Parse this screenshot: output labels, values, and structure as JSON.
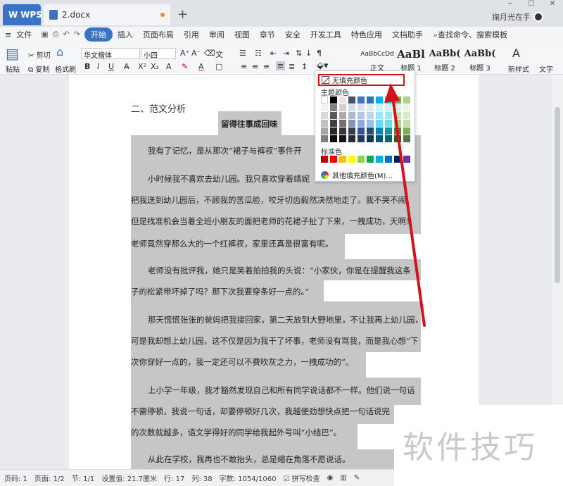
{
  "titlebar": {
    "app_tab": "WPS",
    "doc_tab": "2.docx",
    "user_name": "掬月光在手"
  },
  "menu": {
    "file": "文件",
    "items": [
      "开始",
      "插入",
      "页面布局",
      "引用",
      "审阅",
      "视图",
      "章节",
      "安全",
      "开发工具",
      "特色应用",
      "文档助手"
    ],
    "search": "查找命令、搜索模板"
  },
  "ribbon": {
    "paste": "粘贴",
    "cut": "剪切",
    "copy": "复制",
    "format_painter": "格式刷",
    "font_name": "华文楷体",
    "font_size": "小四",
    "styles": [
      {
        "preview": "AaBbCcDd",
        "label": "正文"
      },
      {
        "preview": "AaBl",
        "label": "标题 1"
      },
      {
        "preview": "AaBb(",
        "label": "标题 2"
      },
      {
        "preview": "AaBb(",
        "label": "标题 3"
      }
    ],
    "new_style": "新样式",
    "text_tool": "文字"
  },
  "shading_popup": {
    "no_fill": "无填充颜色",
    "theme_colors_label": "主题颜色",
    "standard_colors_label": "标准色",
    "more_colors": "其他填充颜色(M)...",
    "theme_colors": [
      [
        "#ffffff",
        "#000000",
        "#e7e6e6",
        "#44546a",
        "#4472c4",
        "#2e75b6",
        "#00b0f0",
        "#26c6da",
        "#70ad47",
        "#a9d18e"
      ],
      [
        "#f2f2f2",
        "#7f7f7f",
        "#d0cece",
        "#d6dce4",
        "#d9e1f2",
        "#ddebf7",
        "#ccf2ff",
        "#ccf5f8",
        "#e2efda",
        "#ecf4e4"
      ],
      [
        "#d9d9d9",
        "#595959",
        "#aeaaaa",
        "#adb9ca",
        "#b4c6e7",
        "#bdd7ee",
        "#99e6ff",
        "#99ebf1",
        "#c6e0b4",
        "#d9e9cb"
      ],
      [
        "#bfbfbf",
        "#404040",
        "#757171",
        "#8497b0",
        "#8ea9db",
        "#9bc2e6",
        "#66d9ff",
        "#66e1ea",
        "#a9d08e",
        "#c5deb1"
      ],
      [
        "#a6a6a6",
        "#262626",
        "#3a3838",
        "#333f4f",
        "#2f5597",
        "#1f4e78",
        "#0085b4",
        "#0d9aa5",
        "#548235",
        "#7fae5b"
      ],
      [
        "#808080",
        "#0d0d0d",
        "#161616",
        "#222a35",
        "#203864",
        "#143450",
        "#005878",
        "#08676e",
        "#375623",
        "#557a3d"
      ]
    ],
    "standard_colors": [
      "#c00000",
      "#ff0000",
      "#ffc000",
      "#ffff00",
      "#92d050",
      "#00b050",
      "#00b0f0",
      "#0070c0",
      "#002060",
      "#7030a0"
    ]
  },
  "document": {
    "section_heading": "二、范文分析",
    "title": "留得往事成回味",
    "paragraphs": [
      "我有了记忆，是从那次“裙子与裤衩”事件开",
      "小时候我不喜欢去幼儿园。我只喜欢穿着靖妮",
      "把我送到幼儿园后，不顾我的苦瓜脸，咬牙切齿毅然决然地走了。我不哭不闹，",
      "但是找准机会当着全班小朋友的面把老师的花裙子扯了下来，一拽成功，天啊！",
      "老师竟然穿那么大的一个红裤衩，家里还真是很富有呢。",
      "老师没有批评我，她只是笑着拍拍我的头说：“小家伙，你是在提醒我这条",
      "子的松紧带坏掉了吗？那下次我要穿条好一点的。”",
      "那天慌慌张张的爸妈把我接回家，第二天放到大野地里，不让我再上幼儿园，",
      "可是我却想上幼儿园，这不仅是因为我干了坏事，老师没有骂我，而是我心想“下",
      "次你穿好一点的，我一定还可以不费吹灰之力，一拽成功的”。",
      "上小学一年级，我才豁然发现自己和所有同学说话都不一样。他们说一句话",
      "不需停顿，我说一句话，却要停顿好几次，我越使劲想快点把一句话说完",
      "的次数就越多，语文学得好的同学给我起外号叫“小结巴”。",
      "从此在学校，我再也不敢抬头，总是缩在角落不愿说话。"
    ]
  },
  "status": {
    "page_num": "页码: 1",
    "pages": "页面: 1/2",
    "section": "节: 1/1",
    "position": "设置值: 21.7厘米",
    "row": "行: 17",
    "col": "列: 38",
    "word_count": "字数: 1054/1060",
    "spell": "拼写检查"
  },
  "watermark": "软件技巧"
}
